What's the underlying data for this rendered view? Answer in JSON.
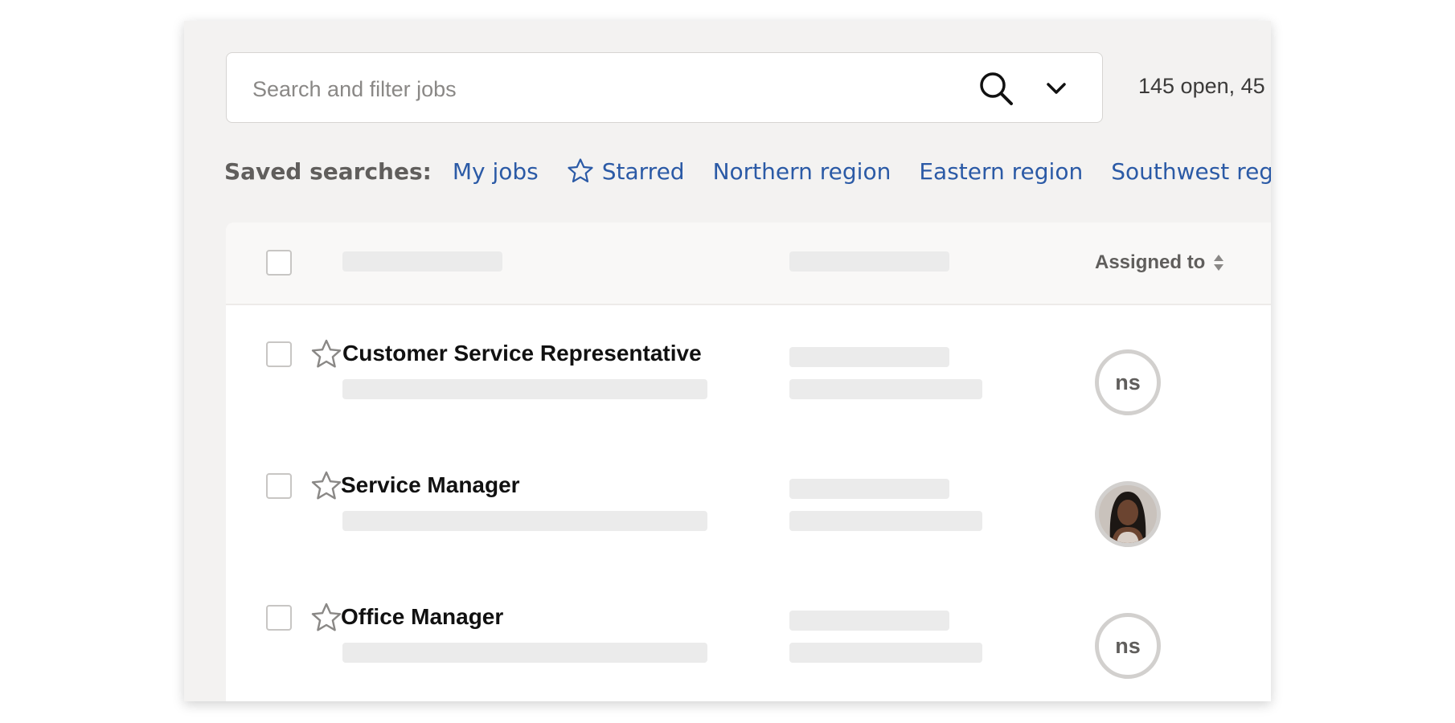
{
  "search": {
    "placeholder": "Search and filter jobs",
    "count_text": "145 open, 45"
  },
  "saved_searches": {
    "label": "Saved searches:",
    "items": [
      {
        "label": "My jobs"
      },
      {
        "label": "Starred",
        "icon": "star-icon"
      },
      {
        "label": "Northern region"
      },
      {
        "label": "Eastern region"
      },
      {
        "label": "Southwest region"
      }
    ]
  },
  "table": {
    "assigned_header": "Assigned to",
    "rows": [
      {
        "title": "Customer Service Representative",
        "assignee": "ns"
      },
      {
        "title": "Service Manager",
        "assignee": "avatar-photo"
      },
      {
        "title": "Office Manager",
        "assignee": "ns"
      }
    ]
  },
  "colors": {
    "link": "#2b5aa6",
    "panel_bg": "#f3f2f1",
    "placeholder_bar": "#ebebeb"
  }
}
